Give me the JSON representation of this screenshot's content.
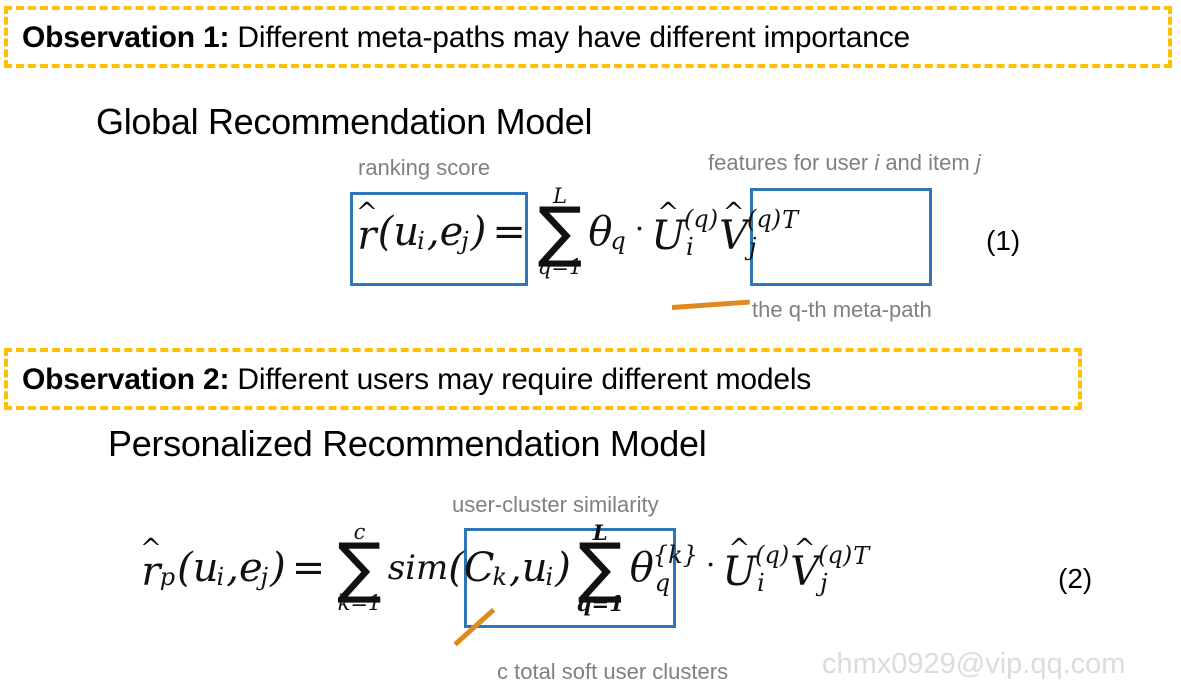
{
  "observations": [
    {
      "id": "observation-1",
      "label": "Observation 1:",
      "text": " Different meta-paths may have different importance"
    },
    {
      "id": "observation-2",
      "label": "Observation 2:",
      "text": " Different users may require different models"
    }
  ],
  "headings": {
    "global": "Global Recommendation Model",
    "personalized": "Personalized Recommendation Model"
  },
  "annotations": {
    "ranking_score": "ranking score",
    "features_prefix": "features for user ",
    "features_i": "i",
    "features_mid": " and item ",
    "features_j": "j",
    "qth_metapath": "the q-th meta-path",
    "user_cluster_similarity": "user-cluster similarity",
    "c_total_clusters": "c total soft user clusters"
  },
  "equations": {
    "eq1": {
      "number": "(1)",
      "lhs_hat": "^",
      "lhs_base": "r",
      "lhs_args_open": "(",
      "lhs_u": "u",
      "lhs_u_sub": "i",
      "lhs_comma": ", ",
      "lhs_e": "e",
      "lhs_e_sub": "j",
      "lhs_args_close": ")",
      "equals": "=",
      "sum_top": "L",
      "sum_glyph": "∑",
      "sum_bottom": "q=1",
      "theta": "θ",
      "theta_sub": "q",
      "dot": "·",
      "u_hat": "^",
      "u_base": "U",
      "u_sup": "(q)",
      "u_sub": "i",
      "v_hat": "^",
      "v_base": "V",
      "v_sup": "(q)",
      "v_sub": "j",
      "transpose": "T"
    },
    "eq2": {
      "number": "(2)",
      "lhs_hat": "^",
      "lhs_base": "r",
      "lhs_sub": "p",
      "lhs_args_open": "(",
      "lhs_u": "u",
      "lhs_u_sub": "i",
      "lhs_comma": ", ",
      "lhs_e": "e",
      "lhs_e_sub": "j",
      "lhs_args_close": ")",
      "equals": "=",
      "sum1_top": "c",
      "sum1_glyph": "∑",
      "sum1_bottom": "k=1",
      "sim_name": "sim",
      "sim_open": "(",
      "sim_c": "C",
      "sim_c_sub": "k",
      "sim_comma": ", ",
      "sim_u": "u",
      "sim_u_sub": "i",
      "sim_close": ")",
      "sum2_top": "L",
      "sum2_glyph": "∑",
      "sum2_bottom": "q=1",
      "theta": "θ",
      "theta_sup": "{k}",
      "theta_sub": "q",
      "dot": "·",
      "u_hat": "^",
      "u_base": "U",
      "u_sup": "(q)",
      "u_sub": "i",
      "v_hat": "^",
      "v_base": "V",
      "v_sup": "(q)",
      "v_sub": "j",
      "transpose": "T"
    }
  },
  "watermark": "chmx0929@vip.qq.com",
  "colors": {
    "callout_border": "#FFC000",
    "highlight_box": "#2E75B6",
    "leader_line": "#E08A1E",
    "annotation_text": "#808080",
    "watermark_text": "#DCDCDC"
  }
}
